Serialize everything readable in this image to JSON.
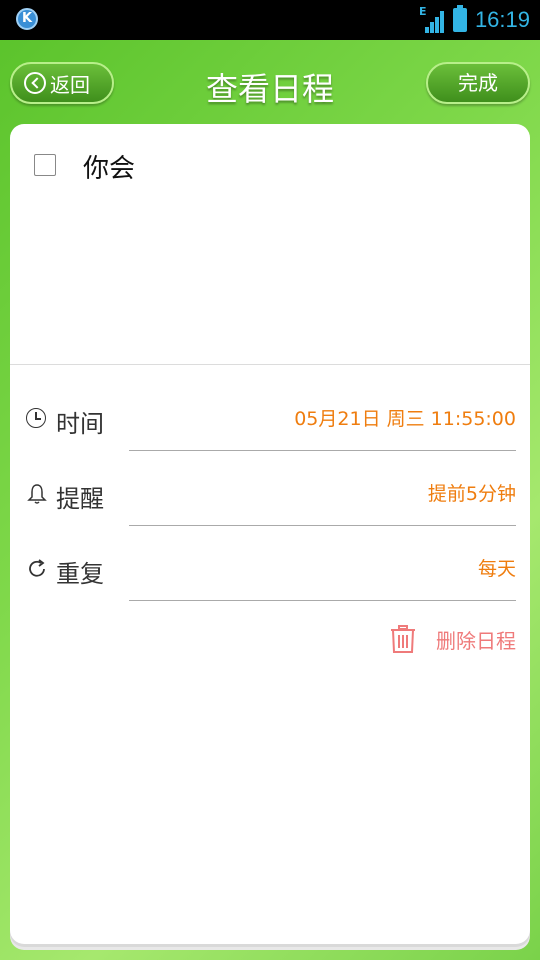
{
  "status_bar": {
    "network": "E",
    "time": "16:19"
  },
  "header": {
    "back_label": "返回",
    "title": "查看日程",
    "done_label": "完成"
  },
  "event": {
    "title": "你会",
    "completed": false
  },
  "details": [
    {
      "label": "时间",
      "value": "05月21日 周三 11:55:00",
      "icon": "clock-icon"
    },
    {
      "label": "提醒",
      "value": "提前5分钟",
      "icon": "bell-icon"
    },
    {
      "label": "重复",
      "value": "每天",
      "icon": "repeat-icon"
    }
  ],
  "delete_label": "删除日程",
  "colors": {
    "accent_value": "#ef7d0f",
    "delete": "#ef7a7a",
    "header_green": "#59c22a",
    "status_blue": "#33b5e5"
  }
}
